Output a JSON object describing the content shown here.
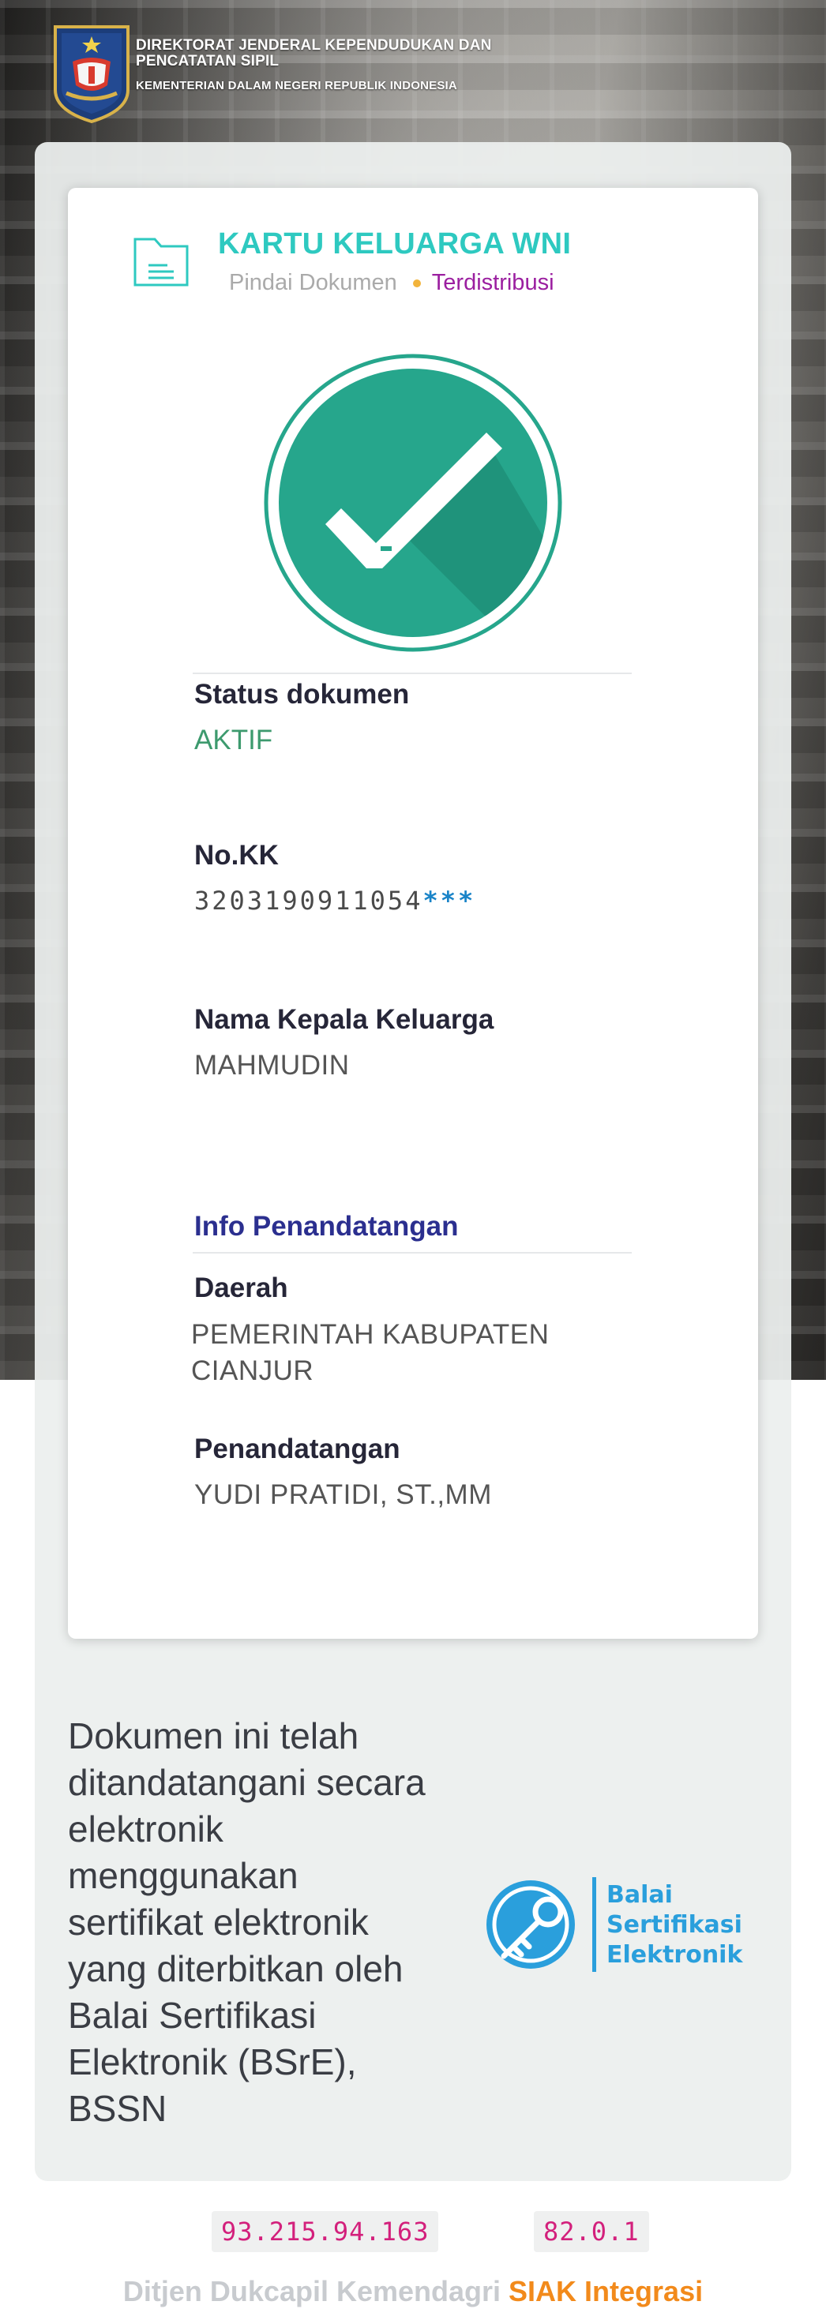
{
  "header": {
    "title_line1": "DIREKTORAT JENDERAL KEPENDUDUKAN DAN",
    "title_line2": "PENCATATAN SIPIL",
    "subtitle": "KEMENTERIAN DALAM NEGERI REPUBLIK INDONESIA",
    "emblem_icon": "garuda-emblem-icon"
  },
  "document": {
    "title": "KARTU KELUARGA WNI",
    "step_scan": "Pindai Dokumen",
    "step_distributed": "Terdistribusi",
    "status_icon": "check-circle-icon"
  },
  "fields": {
    "status_label": "Status dokumen",
    "status_value": "AKTIF",
    "kk_label": "No.KK",
    "kk_value": "3203190911054",
    "kk_mask": "***",
    "head_label": "Nama Kepala Keluarga",
    "head_value": "MAHMUDIN"
  },
  "signing": {
    "section_title": "Info Penandatangan",
    "region_label": "Daerah",
    "region_value_line1": "PEMERINTAH KABUPATEN",
    "region_value_line2": "CIANJUR",
    "signer_label": "Penandatangan",
    "signer_value": "YUDI PRATIDI, ST.,MM"
  },
  "notice": {
    "lines": [
      "Dokumen ini telah",
      "ditandatangani secara",
      "elektronik",
      "menggunakan",
      "sertifikat elektronik",
      "yang diterbitkan oleh",
      "Balai Sertifikasi",
      "Elektronik (BSrE),",
      "BSSN"
    ]
  },
  "bsre_logo": {
    "line1": "Balai",
    "line2": "Sertifikasi",
    "line3": "Elektronik",
    "icon": "key-circle-icon"
  },
  "footer": {
    "ip": "93.215.94.163",
    "version": "82.0.1",
    "org": "Ditjen Dukcapil Kemendagri",
    "product": "SIAK Integrasi"
  },
  "colors": {
    "teal": "#2ec9c0",
    "check_green": "#26a68c",
    "status_green": "#3d9a6e",
    "purple": "#9b1fa0",
    "navy": "#2b2f8f",
    "orange": "#f28a1b",
    "bsre_blue": "#2a9fdc",
    "code_pink": "#d3207c"
  }
}
